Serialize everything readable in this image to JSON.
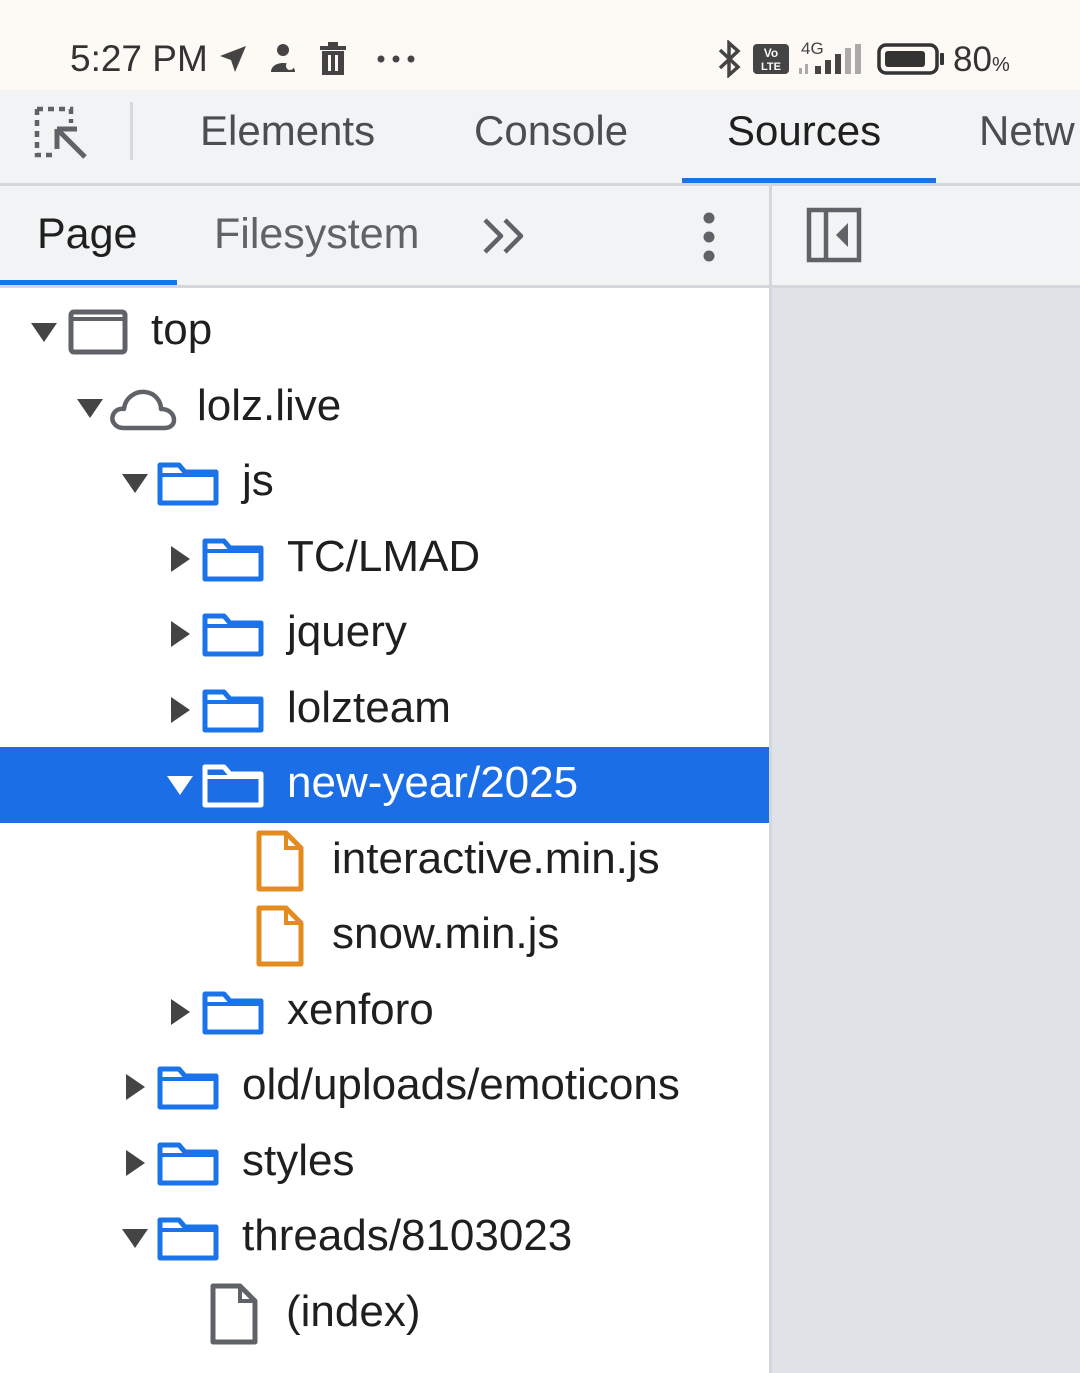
{
  "status_bar": {
    "time": "5:27 PM",
    "network": "4G",
    "volte": "Vo LTE",
    "battery_percent": "80",
    "battery_unit": "%",
    "icons": [
      "navigation-icon",
      "assistant-icon",
      "trash-icon",
      "more-icon",
      "bluetooth-icon",
      "volte-icon",
      "signal-icon",
      "battery-icon"
    ]
  },
  "devtools": {
    "main_tabs": [
      {
        "label": "Elements"
      },
      {
        "label": "Console"
      },
      {
        "label": "Sources",
        "active": true
      },
      {
        "label": "Netw"
      }
    ],
    "navigator_tabs": [
      {
        "label": "Page",
        "active": true
      },
      {
        "label": "Filesystem"
      }
    ]
  },
  "tree": [
    {
      "label": "top",
      "type": "frame",
      "expanded": true,
      "depth": 0
    },
    {
      "label": "lolz.live",
      "type": "cloud",
      "expanded": true,
      "depth": 1
    },
    {
      "label": "js",
      "type": "folder",
      "expanded": true,
      "depth": 2
    },
    {
      "label": "TC/LMAD",
      "type": "folder",
      "expanded": false,
      "depth": 3
    },
    {
      "label": "jquery",
      "type": "folder",
      "expanded": false,
      "depth": 3
    },
    {
      "label": "lolzteam",
      "type": "folder",
      "expanded": false,
      "depth": 3
    },
    {
      "label": "new-year/2025",
      "type": "folder",
      "expanded": true,
      "depth": 3,
      "selected": true
    },
    {
      "label": "interactive.min.js",
      "type": "js-file",
      "depth": 4
    },
    {
      "label": "snow.min.js",
      "type": "js-file",
      "depth": 4
    },
    {
      "label": "xenforo",
      "type": "folder",
      "expanded": false,
      "depth": 3
    },
    {
      "label": "old/uploads/emoticons",
      "type": "folder",
      "expanded": false,
      "depth": 2
    },
    {
      "label": "styles",
      "type": "folder",
      "expanded": false,
      "depth": 2
    },
    {
      "label": "threads/8103023",
      "type": "folder",
      "expanded": true,
      "depth": 2
    },
    {
      "label": "(index)",
      "type": "document",
      "depth": 3
    }
  ],
  "colors": {
    "accent": "#1a73e8",
    "selected_row": "#1b6ee6",
    "folder": "#1a73e8",
    "js_file": "#e38b1e",
    "right_pane": "#dfe2e6"
  }
}
